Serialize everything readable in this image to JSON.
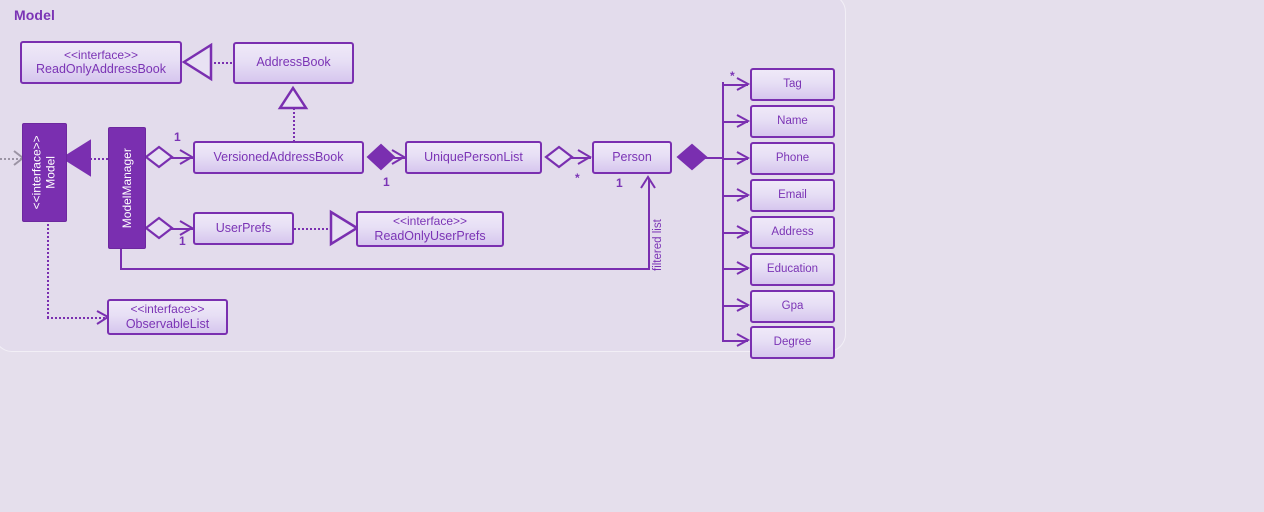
{
  "diagram": {
    "title": "Model",
    "type": "uml-class-diagram",
    "colors": {
      "background": "#e5dfec",
      "panel": "#e3dcec",
      "stroke": "#7a2fb0",
      "text": "#7b34b5",
      "box_fill_top": "#efe9f8",
      "box_fill_bottom": "#d6c6ee",
      "solid_fill": "#7a2fb0",
      "solid_text": "#ffffff",
      "external_dotted": "#9b94a4"
    },
    "classes": {
      "read_only_address_book": {
        "stereotype": "<<interface>>",
        "name": "ReadOnlyAddressBook"
      },
      "address_book": {
        "name": "AddressBook"
      },
      "model": {
        "stereotype": "<<interface>>",
        "name": "Model"
      },
      "model_manager": {
        "name": "ModelManager"
      },
      "versioned_address_book": {
        "name": "VersionedAddressBook"
      },
      "unique_person_list": {
        "name": "UniquePersonList"
      },
      "person": {
        "name": "Person"
      },
      "user_prefs": {
        "name": "UserPrefs"
      },
      "read_only_user_prefs": {
        "stereotype": "<<interface>>",
        "name": "ReadOnlyUserPrefs"
      },
      "observable_list": {
        "stereotype": "<<interface>>",
        "name": "ObservableList"
      }
    },
    "attributes": [
      {
        "name": "Tag"
      },
      {
        "name": "Name"
      },
      {
        "name": "Phone"
      },
      {
        "name": "Email"
      },
      {
        "name": "Address"
      },
      {
        "name": "Education"
      },
      {
        "name": "Gpa"
      },
      {
        "name": "Degree"
      }
    ],
    "multiplicities": {
      "model_manager_to_versioned": "1",
      "versioned_to_unique_left": "1",
      "unique_to_person": "*",
      "model_manager_to_userprefs": "1",
      "person_filtered": "1",
      "person_to_tag": "*"
    },
    "labels": {
      "filtered_list": "filtered list"
    }
  },
  "chart_data": {
    "type": "diagram",
    "title": "Model",
    "nodes": [
      "ReadOnlyAddressBook",
      "AddressBook",
      "Model",
      "ModelManager",
      "VersionedAddressBook",
      "UniquePersonList",
      "Person",
      "UserPrefs",
      "ReadOnlyUserPrefs",
      "ObservableList",
      "Tag",
      "Name",
      "Phone",
      "Email",
      "Address",
      "Education",
      "Gpa",
      "Degree"
    ],
    "edges": [
      {
        "from": "AddressBook",
        "to": "ReadOnlyAddressBook",
        "type": "realization"
      },
      {
        "from": "VersionedAddressBook",
        "to": "AddressBook",
        "type": "generalization"
      },
      {
        "from": "ModelManager",
        "to": "Model",
        "type": "realization"
      },
      {
        "from": "ModelManager",
        "to": "VersionedAddressBook",
        "type": "aggregation",
        "multiplicity": "1"
      },
      {
        "from": "ModelManager",
        "to": "UserPrefs",
        "type": "aggregation",
        "multiplicity": "1"
      },
      {
        "from": "UserPrefs",
        "to": "ReadOnlyUserPrefs",
        "type": "realization"
      },
      {
        "from": "VersionedAddressBook",
        "to": "UniquePersonList",
        "type": "composition",
        "multiplicity": "1"
      },
      {
        "from": "UniquePersonList",
        "to": "Person",
        "type": "aggregation",
        "multiplicity": "*"
      },
      {
        "from": "ModelManager",
        "to": "Person",
        "type": "association",
        "multiplicity": "1",
        "label": "filtered list"
      },
      {
        "from": "Model",
        "to": "ObservableList",
        "type": "dependency"
      },
      {
        "from": "Person",
        "to": "Tag",
        "type": "composition",
        "multiplicity": "*"
      },
      {
        "from": "Person",
        "to": "Name",
        "type": "composition"
      },
      {
        "from": "Person",
        "to": "Phone",
        "type": "composition"
      },
      {
        "from": "Person",
        "to": "Email",
        "type": "composition"
      },
      {
        "from": "Person",
        "to": "Address",
        "type": "composition"
      },
      {
        "from": "Person",
        "to": "Education",
        "type": "composition"
      },
      {
        "from": "Person",
        "to": "Gpa",
        "type": "composition"
      },
      {
        "from": "Person",
        "to": "Degree",
        "type": "composition"
      }
    ]
  }
}
